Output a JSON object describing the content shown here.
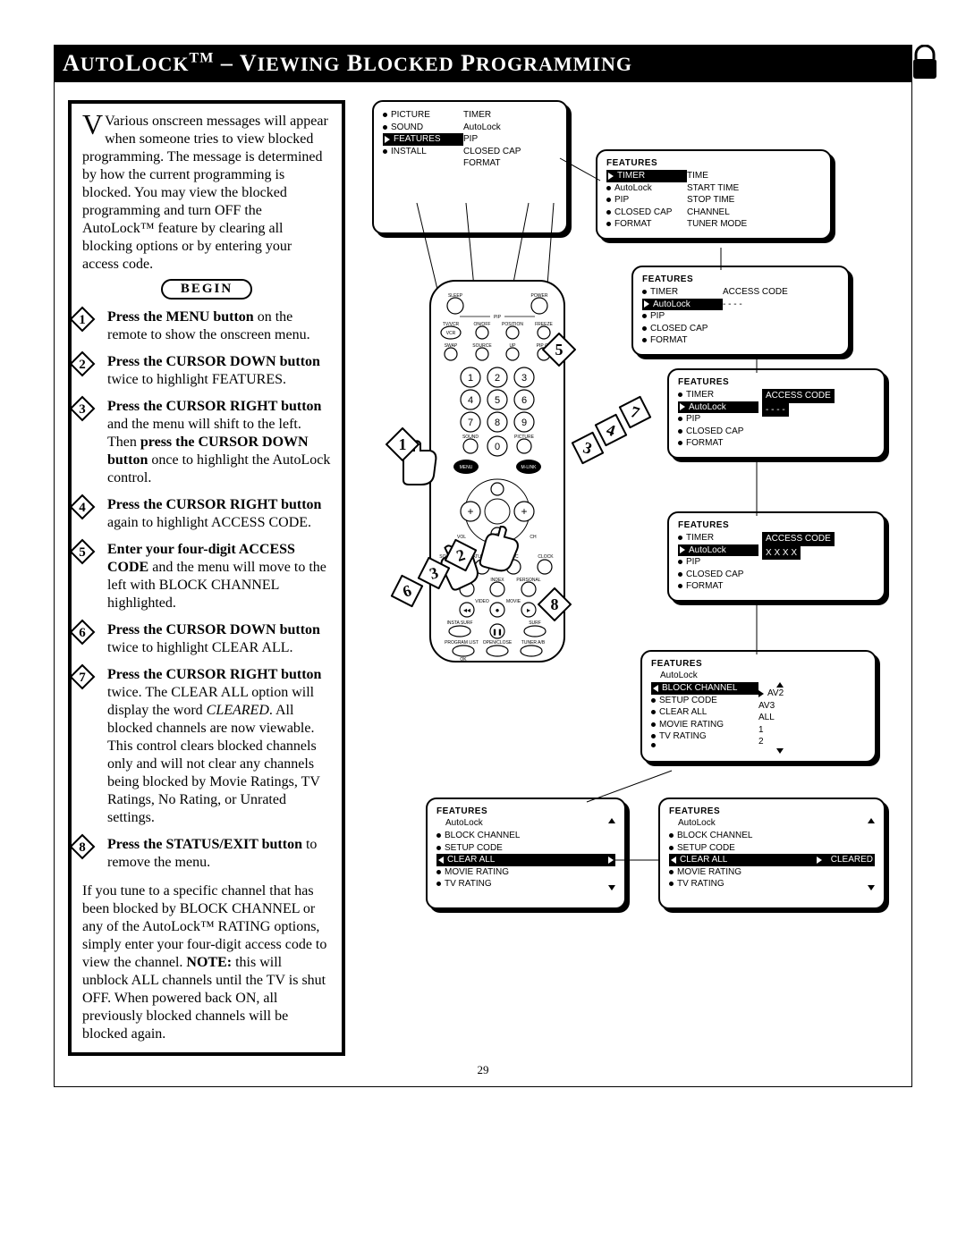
{
  "page_number": "29",
  "title": {
    "main": "AutoLock™ – Viewing Blocked Programming"
  },
  "intro": "Various onscreen messages will appear when someone tries to view blocked programming. The message is determined by how the current programming is blocked. You may view the blocked programming and turn OFF the AutoLock™ feature by clearing all blocking options or by entering your access code.",
  "begin": "BEGIN",
  "steps": [
    {
      "n": "1",
      "bold": "Press the MENU button",
      "rest": " on the remote to show the onscreen menu."
    },
    {
      "n": "2",
      "bold": "Press the CURSOR DOWN button",
      "rest": " twice to highlight FEATURES."
    },
    {
      "n": "3",
      "bold": "Press the CURSOR RIGHT button",
      "rest": " and the menu will shift to the left. Then ",
      "bold2": "press the CURSOR DOWN button",
      "rest2": " once to highlight the AutoLock control."
    },
    {
      "n": "4",
      "bold": "Press the CURSOR RIGHT button",
      "rest": " again to highlight ACCESS CODE."
    },
    {
      "n": "5",
      "bold": "Enter your four-digit ACCESS CODE",
      "rest": " and the menu will move to the left with BLOCK CHANNEL highlighted."
    },
    {
      "n": "6",
      "bold": "Press the CURSOR DOWN button",
      "rest": " twice to highlight CLEAR ALL."
    },
    {
      "n": "7",
      "bold": "Press the CURSOR RIGHT button",
      "rest": " twice. The CLEAR ALL option will display the word ",
      "ital": "CLEARED",
      "rest2": ". All blocked channels are now viewable. This control clears blocked channels only and will not clear any channels being blocked by Movie Ratings, TV Ratings, No Rating, or Unrated settings."
    },
    {
      "n": "8",
      "bold": "Press the STATUS/EXIT button",
      "rest": " to remove the menu."
    }
  ],
  "note": "If you tune to a specific channel that has been blocked by BLOCK CHANNEL or any of the AutoLock™ RATING options, simply enter your four-digit access code to view the channel. ",
  "note_bold": "NOTE:",
  "note2": " this will unblock ALL channels until the TV is shut OFF. When powered back ON, all previously blocked channels will be blocked again.",
  "osd": {
    "o1": {
      "left": [
        "PICTURE",
        "SOUND",
        "FEATURES",
        "INSTALL"
      ],
      "right": [
        "TIMER",
        "AutoLock",
        "PIP",
        "CLOSED CAP",
        "FORMAT"
      ]
    },
    "o2": {
      "hdr": "FEATURES",
      "left": [
        "TIMER",
        "AutoLock",
        "PIP",
        "CLOSED CAP",
        "FORMAT"
      ],
      "right": [
        "TIME",
        "START TIME",
        "STOP TIME",
        "CHANNEL",
        "TUNER MODE"
      ]
    },
    "o3": {
      "hdr": "FEATURES",
      "left": [
        "TIMER",
        "AutoLock",
        "PIP",
        "CLOSED CAP",
        "FORMAT"
      ],
      "right_label": "ACCESS CODE",
      "right_val": "- - - -"
    },
    "o4": {
      "hdr": "FEATURES",
      "left": [
        "TIMER",
        "AutoLock",
        "PIP",
        "CLOSED CAP",
        "FORMAT"
      ],
      "right_label": "ACCESS CODE",
      "right_val": "- - - -"
    },
    "o5": {
      "hdr": "FEATURES",
      "left": [
        "TIMER",
        "AutoLock",
        "PIP",
        "CLOSED CAP",
        "FORMAT"
      ],
      "right_label": "ACCESS CODE",
      "right_val": "X X X X"
    },
    "o6": {
      "hdr": "FEATURES",
      "sub": "AutoLock",
      "left": [
        "BLOCK CHANNEL",
        "SETUP CODE",
        "CLEAR ALL",
        "MOVIE RATING",
        "TV RATING",
        ""
      ],
      "right": [
        "AV2",
        "AV3",
        "ALL",
        "1",
        "2"
      ]
    },
    "o7": {
      "hdr": "FEATURES",
      "sub": "AutoLock",
      "left": [
        "BLOCK CHANNEL",
        "SETUP CODE",
        "CLEAR ALL",
        "MOVIE RATING",
        "TV RATING"
      ]
    },
    "o8": {
      "hdr": "FEATURES",
      "sub": "AutoLock",
      "left": [
        "BLOCK CHANNEL",
        "SETUP CODE",
        "CLEAR ALL",
        "MOVIE RATING",
        "TV RATING"
      ],
      "cleared": "CLEARED"
    }
  },
  "callouts": [
    "1",
    "2",
    "3",
    "4",
    "5",
    "6",
    "7",
    "8"
  ],
  "remote_labels": {
    "sleep": "SLEEP",
    "power": "POWER",
    "pip": "PIP",
    "tvvcr": "TV/VCR",
    "onoff": "ON/OFF",
    "position": "POSITION",
    "freeze": "FREEZE",
    "swap": "SWAP",
    "source": "SOURCE",
    "up": "UP",
    "pipch": "PIP CH",
    "sound": "SOUND",
    "picture": "PICTURE",
    "menu": "MENU",
    "mlink": "M-LINK",
    "vol": "VOL",
    "ch": "CH",
    "mute": "MUTE",
    "clock": "CLOCK",
    "cc": "CC",
    "statusexit": "STATUS/EXIT",
    "source2": "SOURCE",
    "itrrec": "ITR REC",
    "index": "INDEX",
    "personal": "PERSONAL",
    "video": "VIDEO",
    "movie": "MOVIE",
    "instasurf": "INSTA SURF",
    "surf": "SURF",
    "programlist": "PROGRAM LIST",
    "openclose": "OPEN/CLOSE",
    "tunerab": "TUNER A/B",
    "ok": "OK"
  }
}
